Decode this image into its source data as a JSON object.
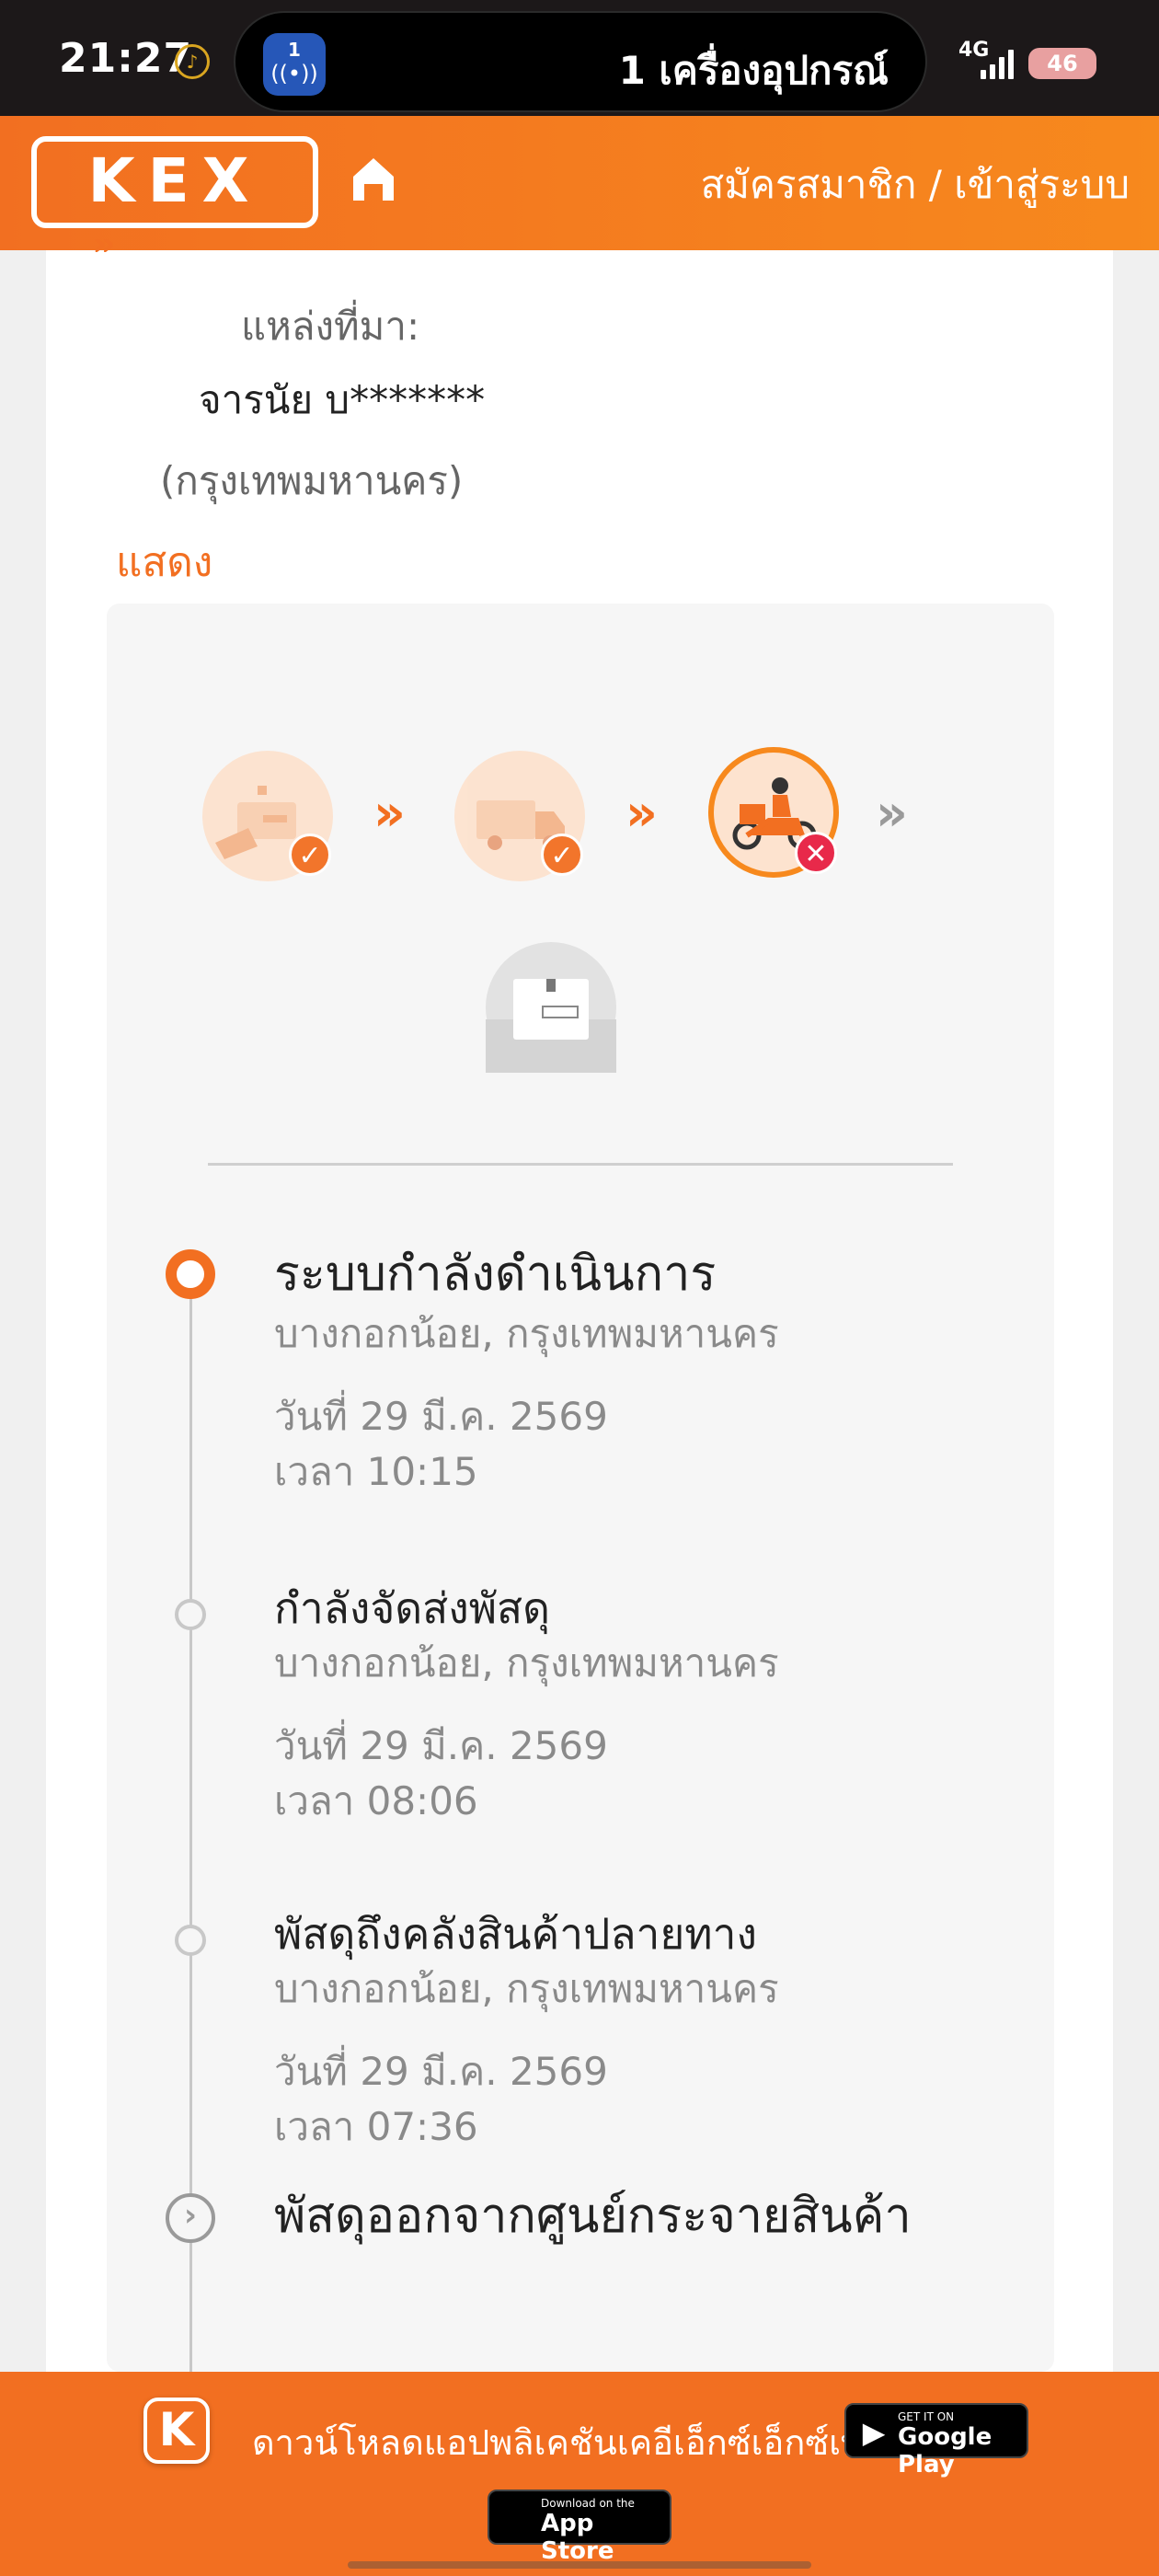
{
  "status_bar": {
    "time": "21:27",
    "island_app_badge": "1",
    "island_text": "1 เครื่องอุปกรณ์",
    "network": "4G",
    "battery": "46"
  },
  "header": {
    "logo_text": "KEX",
    "register_link": "สมัครสมาชิก / เข้าสู่ระบบ",
    "brand_color": "#f26f21"
  },
  "source": {
    "label": "แหล่งที่มา:",
    "name": "จารนัย บ*******",
    "province": "(กรุงเทพมหานคร)",
    "show_link": "แสดง"
  },
  "progress_steps": [
    {
      "icon": "parcel-received-icon",
      "state": "done"
    },
    {
      "icon": "truck-icon",
      "state": "done"
    },
    {
      "icon": "motorbike-courier-icon",
      "state": "failed"
    },
    {
      "icon": "parcel-delivered-icon",
      "state": "pending"
    }
  ],
  "events": [
    {
      "status": "ระบบกำลังดำเนินการ",
      "location": "บางกอกน้อย, กรุงเทพมหานคร",
      "date": "วันที่ 29 มี.ค. 2569",
      "time": "เวลา 10:15"
    },
    {
      "status": "กำลังจัดส่งพัสดุ",
      "location": "บางกอกน้อย, กรุงเทพมหานคร",
      "date": "วันที่ 29 มี.ค. 2569",
      "time": "เวลา 08:06"
    },
    {
      "status": "พัสดุถึงคลังสินค้าปลายทาง",
      "location": "บางกอกน้อย, กรุงเทพมหานคร",
      "date": "วันที่ 29 มี.ค. 2569",
      "time": "เวลา 07:36"
    },
    {
      "status": "พัสดุออกจากศูนย์กระจายสินค้า"
    }
  ],
  "banner": {
    "text": "ดาวน์โหลดแอปพลิเคชันเคอีเอ็กซ์เอ็กซ์เพรส",
    "google_play_small": "GET IT ON",
    "google_play_large": "Google Play",
    "app_store_small": "Download on the",
    "app_store_large": "App Store"
  }
}
